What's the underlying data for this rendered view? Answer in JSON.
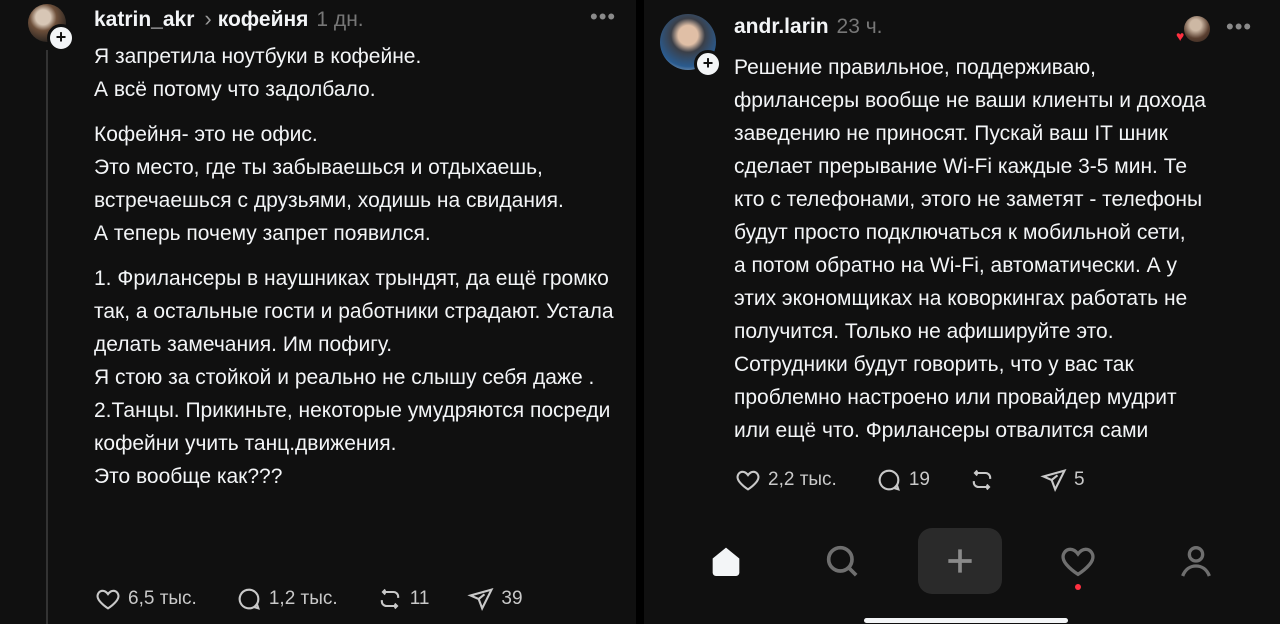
{
  "left_post": {
    "author": "katrin_akr",
    "topic": "кофейня",
    "time": "1 дн.",
    "more_label": "•••",
    "paragraphs": [
      [
        "Я запретила ноутбуки в кофейне.",
        "А  всё потому что задолбало."
      ],
      [
        "Кофейня- это не офис.",
        "Это место, где ты забываешься и отдыхаешь, встречаешься с друзьями, ходишь на свидания.",
        "А теперь  почему запрет появился."
      ],
      [
        "1. Фрилансеры в наушниках трындят, да ещё громко так, а остальные гости и работники страдают. Устала делать замечания. Им пофигу.",
        "Я стою за стойкой и реально не слышу себя даже .",
        "2.Танцы. Прикиньте, некоторые умудряются посреди кофейни учить танц.движения.",
        "Это вообще как???"
      ]
    ],
    "likes": "6,5 тыс.",
    "replies": "1,2 тыс.",
    "reposts": "11",
    "shares": "39"
  },
  "right_post": {
    "author": "andr.larin",
    "time": "23 ч.",
    "more_label": "•••",
    "text_lines": [
      "Решение правильное, поддерживаю,",
      "фрилансеры вообще не ваши клиенты и дохода",
      "заведению не приносят. Пускай ваш IT шник",
      "сделает прерывание Wi-Fi каждые 3-5 мин. Те",
      "кто с телефонами, этого не заметят - телефоны",
      "будут просто подключаться к мобильной сети,",
      "а потом обратно на Wi-Fi, автоматически. А у",
      "этих экономщиках на коворкингах работать не",
      "получится. Только не афишируйте это.",
      "Сотрудники будут говорить, что у вас так",
      "проблемно настроено или провайдер мудрит",
      "или ещё что. Фрилансеры отвалится сами"
    ],
    "likes": "2,2 тыс.",
    "replies": "19",
    "shares": "5"
  },
  "nav": {
    "items": [
      "home-icon",
      "search-icon",
      "create-icon",
      "activity-heart-icon",
      "profile-icon"
    ],
    "active": "home-icon"
  },
  "colors": {
    "background": "#101010",
    "text": "#f3f5f7",
    "muted": "#777777",
    "notification": "#ff3040"
  }
}
